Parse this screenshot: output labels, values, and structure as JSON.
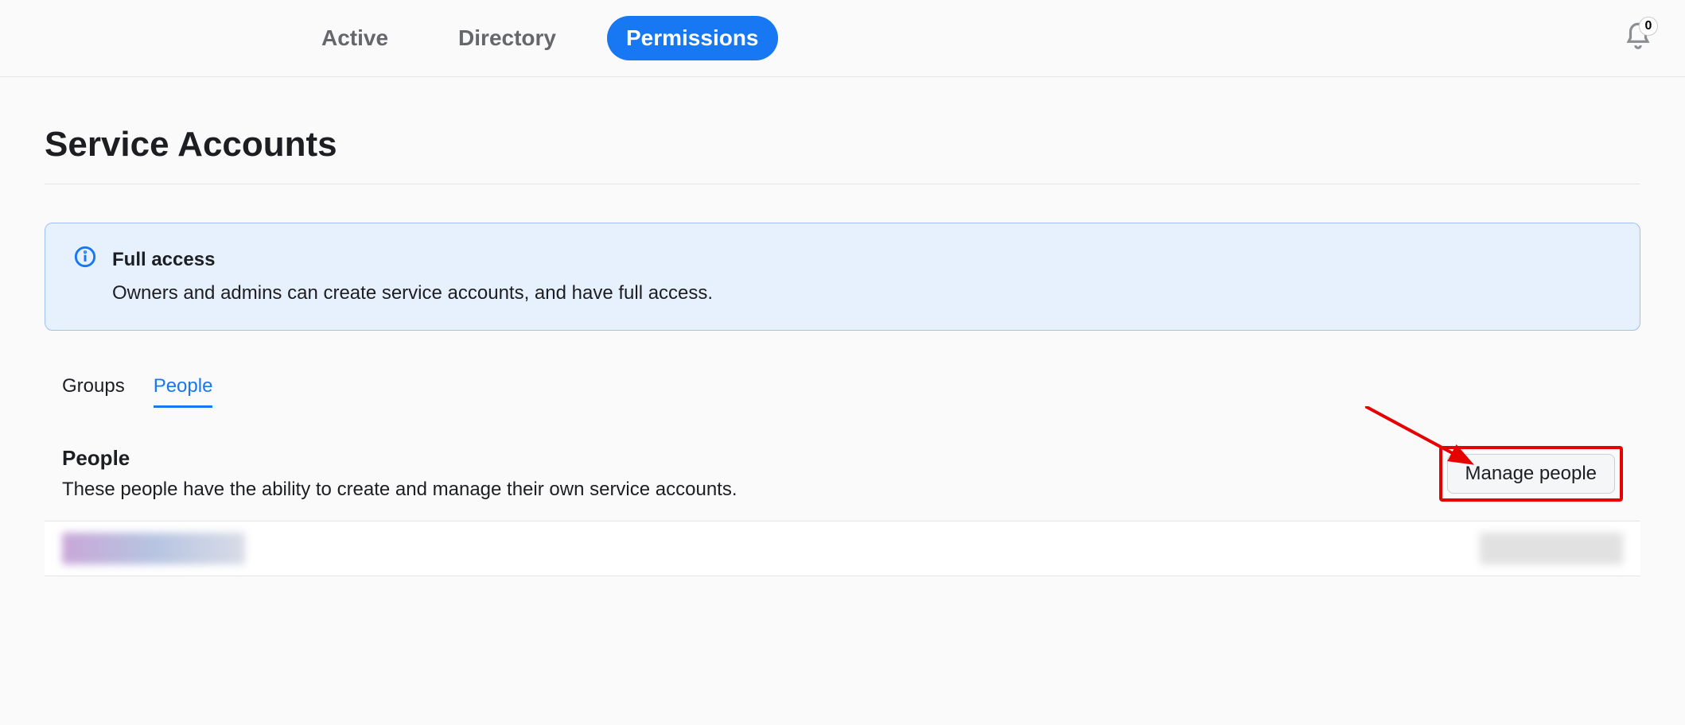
{
  "nav": {
    "tabs": [
      {
        "label": "Active",
        "active": false
      },
      {
        "label": "Directory",
        "active": false
      },
      {
        "label": "Permissions",
        "active": true
      }
    ],
    "notification_count": "0"
  },
  "page": {
    "title": "Service Accounts"
  },
  "info": {
    "title": "Full access",
    "body": "Owners and admins can create service accounts, and have full access."
  },
  "subtabs": [
    {
      "label": "Groups",
      "selected": false
    },
    {
      "label": "People",
      "selected": true
    }
  ],
  "people_section": {
    "heading": "People",
    "description": "These people have the ability to create and manage their own service accounts.",
    "manage_button": "Manage people"
  }
}
